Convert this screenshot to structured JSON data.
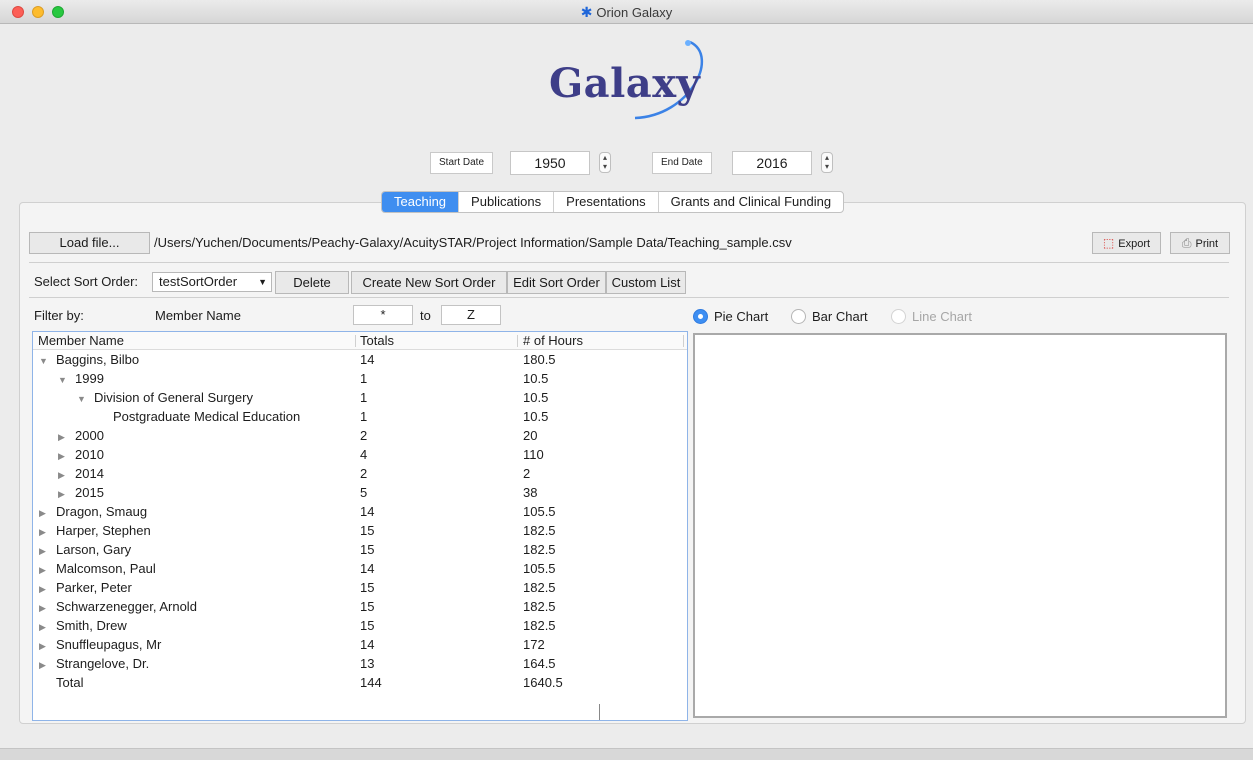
{
  "window": {
    "title": "Orion Galaxy",
    "title_icon": "star-icon"
  },
  "logo": {
    "text": "Galaxy"
  },
  "dates": {
    "start_label": "Start Date",
    "start_value": "1950",
    "end_label": "End Date",
    "end_value": "2016"
  },
  "tabs": [
    {
      "label": "Teaching",
      "active": true
    },
    {
      "label": "Publications",
      "active": false
    },
    {
      "label": "Presentations",
      "active": false
    },
    {
      "label": "Grants and Clinical Funding",
      "active": false
    }
  ],
  "toolbar": {
    "load_label": "Load file...",
    "file_path": "/Users/Yuchen/Documents/Peachy-Galaxy/AcuitySTAR/Project Information/Sample Data/Teaching_sample.csv",
    "export_label": "Export",
    "print_label": "Print"
  },
  "sort": {
    "label": "Select Sort Order:",
    "selected": "testSortOrder",
    "delete_label": "Delete",
    "create_label": "Create New Sort Order",
    "edit_label": "Edit Sort Order",
    "custom_label": "Custom List"
  },
  "filter": {
    "label": "Filter by:",
    "field": "Member Name",
    "from_value": "*",
    "to_label": "to",
    "to_value": "Z"
  },
  "charts": {
    "pie_label": "Pie Chart",
    "bar_label": "Bar Chart",
    "line_label": "Line Chart",
    "selected": "Pie Chart"
  },
  "table": {
    "columns": [
      "Member Name",
      "Totals",
      "# of Hours"
    ],
    "rows": [
      {
        "name": "Baggins, Bilbo",
        "level": 0,
        "toggle": "open",
        "total": "14",
        "hours": "180.5"
      },
      {
        "name": "1999",
        "level": 1,
        "toggle": "open",
        "total": "1",
        "hours": "10.5"
      },
      {
        "name": "Division of General Surgery",
        "level": 2,
        "toggle": "open",
        "total": "1",
        "hours": "10.5"
      },
      {
        "name": "Postgraduate Medical Education",
        "level": 3,
        "toggle": "none",
        "total": "1",
        "hours": "10.5"
      },
      {
        "name": "2000",
        "level": 1,
        "toggle": "closed",
        "total": "2",
        "hours": "20"
      },
      {
        "name": "2010",
        "level": 1,
        "toggle": "closed",
        "total": "4",
        "hours": "110"
      },
      {
        "name": "2014",
        "level": 1,
        "toggle": "closed",
        "total": "2",
        "hours": "2"
      },
      {
        "name": "2015",
        "level": 1,
        "toggle": "closed",
        "total": "5",
        "hours": "38"
      },
      {
        "name": "Dragon, Smaug",
        "level": 0,
        "toggle": "closed",
        "total": "14",
        "hours": "105.5"
      },
      {
        "name": "Harper, Stephen",
        "level": 0,
        "toggle": "closed",
        "total": "15",
        "hours": "182.5"
      },
      {
        "name": "Larson, Gary",
        "level": 0,
        "toggle": "closed",
        "total": "15",
        "hours": "182.5"
      },
      {
        "name": "Malcomson, Paul",
        "level": 0,
        "toggle": "closed",
        "total": "14",
        "hours": "105.5"
      },
      {
        "name": "Parker, Peter",
        "level": 0,
        "toggle": "closed",
        "total": "15",
        "hours": "182.5"
      },
      {
        "name": "Schwarzenegger, Arnold",
        "level": 0,
        "toggle": "closed",
        "total": "15",
        "hours": "182.5"
      },
      {
        "name": "Smith, Drew",
        "level": 0,
        "toggle": "closed",
        "total": "15",
        "hours": "182.5"
      },
      {
        "name": "Snuffleupagus, Mr",
        "level": 0,
        "toggle": "closed",
        "total": "14",
        "hours": "172"
      },
      {
        "name": "Strangelove, Dr.",
        "level": 0,
        "toggle": "closed",
        "total": "13",
        "hours": "164.5"
      },
      {
        "name": "Total",
        "level": 0,
        "toggle": "none",
        "total": "144",
        "hours": "1640.5"
      }
    ]
  }
}
